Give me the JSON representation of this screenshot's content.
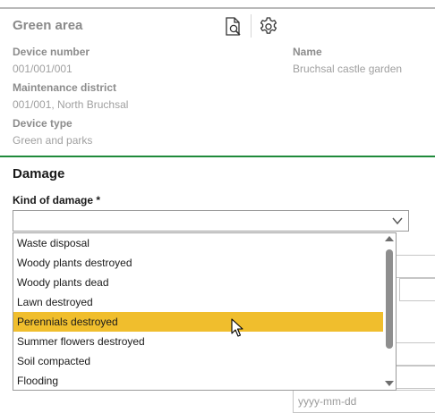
{
  "panel": {
    "title": "Green area"
  },
  "toolbar": {
    "icons": [
      "document-search-icon",
      "gear-icon"
    ]
  },
  "details": {
    "device_number_label": "Device number",
    "device_number_value": "001/001/001",
    "name_label": "Name",
    "name_value": "Bruchsal castle garden",
    "maintenance_district_label": "Maintenance district",
    "maintenance_district_value": "001/001, North Bruchsal",
    "device_type_label": "Device type",
    "device_type_value": "Green and parks"
  },
  "damage": {
    "section_title": "Damage",
    "kind_label": "Kind of damage *",
    "kind_value": "",
    "options": [
      "Waste disposal",
      "Woody plants destroyed",
      "Woody plants dead",
      "Lawn destroyed",
      "Perennials destroyed",
      "Summer flowers destroyed",
      "Soil compacted",
      "Flooding"
    ],
    "highlighted_option": "Perennials destroyed"
  },
  "date_field": {
    "placeholder": "yyyy-mm-dd"
  },
  "colors": {
    "highlight": "#f0be2d",
    "divider_green": "#1f8a3a"
  }
}
